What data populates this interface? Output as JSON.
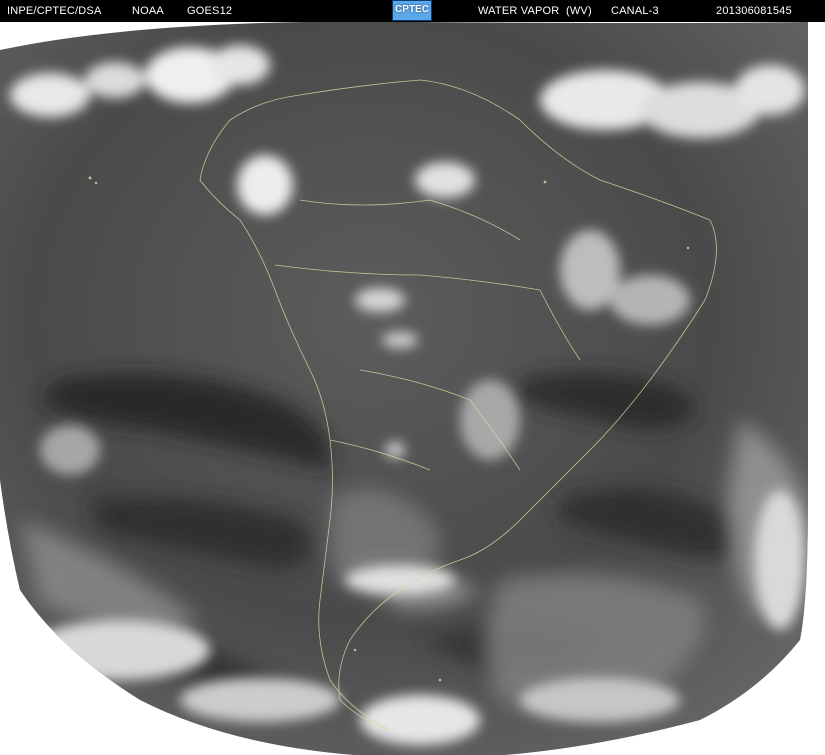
{
  "header": {
    "source": "INPE/CPTEC/DSA",
    "agency": "NOAA",
    "satellite": "GOES12",
    "logo_text": "CPTEC",
    "channel_name": "WATER VAPOR  (WV)",
    "channel": "CANAL-3",
    "timestamp": "201306081545"
  },
  "colors": {
    "header_bg": "#000000",
    "header_text": "#ffffff",
    "background": "#ffffff",
    "earth_dark": "#2a2a2a",
    "earth_mid": "#6f6f6f",
    "cloud_bright": "#f2f2f2",
    "coastline": "#d8d8a0"
  },
  "image": {
    "type": "satellite-water-vapor-imagery",
    "region": "South America"
  }
}
